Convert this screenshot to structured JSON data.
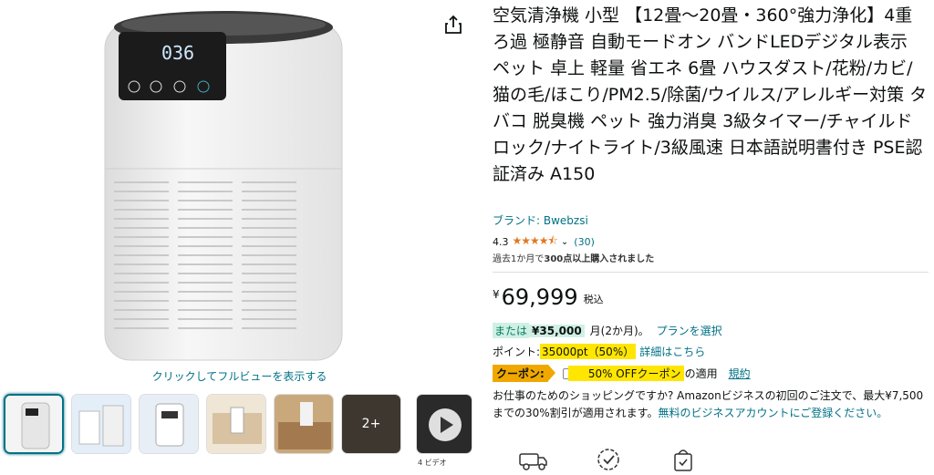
{
  "gallery": {
    "click_hint": "クリックしてフルビューを表示する",
    "more_label": "2+",
    "video_label": "4 ビデオ",
    "display_reading": "036"
  },
  "product": {
    "title": "空気清浄機 小型 【12畳～20畳・360°強力浄化】4重ろ過 極静音 自動モードオン バンドLEDデジタル表示 ペット 卓上 軽量 省エネ 6畳 ハウスダスト/花粉/カビ/猫の毛/ほこり/PM2.5/除菌/ウイルス/アレルギー対策 タバコ 脱臭機 ペット 強力消臭 3級タイマー/チャイルドロック/ナイトライト/3級風速 日本語説明書付き PSE認証済み A150",
    "brand": "ブランド: Bwebzsi",
    "rating": 4.3,
    "rating_text": "4.3",
    "stars": "★★★★⯪",
    "review_count": "(30)",
    "bought_prefix": "過去1か月で",
    "bought_bold": "300点以上購入されました"
  },
  "price": {
    "yen": "¥",
    "amount": "69,999",
    "tax": "税込"
  },
  "installment": {
    "or": "または",
    "amount": "¥35,000",
    "months": "月(2か月)。",
    "link": "プランを選択"
  },
  "points": {
    "label": "ポイント:",
    "value": "35000pt（50%）",
    "link": "詳細はこちら"
  },
  "coupon": {
    "badge": "クーポン:",
    "text": "50% OFFクーポン",
    "apply": "の適用",
    "link": "規約"
  },
  "business": {
    "text": "お仕事のためのショッピングですか? Amazonビジネスの初回のご注文で、最大¥7,500までの30%割引が適用されます。",
    "link": "無料のビジネスアカウントにご登録ください。"
  },
  "colors": {
    "link": "#007185",
    "star": "#de7921",
    "highlight": "#ffe600",
    "coupon_badge": "#f0a800",
    "install_bg": "#cff0e4"
  },
  "icons": [
    "share-icon",
    "truck-icon",
    "badge-check-icon",
    "bag-check-icon",
    "play-icon",
    "chevron-down-icon"
  ]
}
